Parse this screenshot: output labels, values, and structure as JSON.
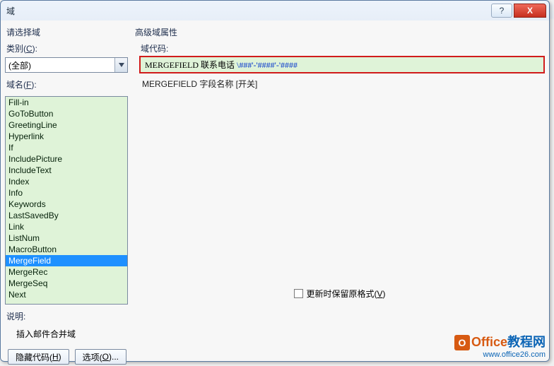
{
  "titlebar": {
    "title": "域",
    "help_icon": "?",
    "close_icon": "X"
  },
  "left": {
    "select_label": "请选择域",
    "category_label_prefix": "类别(",
    "category_label_key": "C",
    "category_label_suffix": "):",
    "category_value": "(全部)",
    "names_label_prefix": "域名(",
    "names_label_key": "F",
    "names_label_suffix": "):",
    "items": [
      "Fill-in",
      "GoToButton",
      "GreetingLine",
      "Hyperlink",
      "If",
      "IncludePicture",
      "IncludeText",
      "Index",
      "Info",
      "Keywords",
      "LastSavedBy",
      "Link",
      "ListNum",
      "MacroButton",
      "MergeField",
      "MergeRec",
      "MergeSeq",
      "Next"
    ],
    "selected_index": 14
  },
  "right": {
    "adv_label": "高级域属性",
    "code_label": "域代码:",
    "code_prefix": "MERGEFIELD  联系电话 ",
    "code_tail": "\\###'-'####'-'####",
    "syntax": "MERGEFIELD 字段名称 [开关]",
    "preserve_prefix": "更新时保留原格式(",
    "preserve_key": "V",
    "preserve_suffix": ")"
  },
  "desc": {
    "label": "说明:",
    "text": "插入邮件合并域"
  },
  "buttons": {
    "hide_prefix": "隐藏代码(",
    "hide_key": "H",
    "options_prefix": "选项(",
    "options_key": "O",
    "suffix": ")..."
  },
  "watermark": {
    "brand1": "Office",
    "brand2": "教程网",
    "url": "www.office26.com"
  }
}
